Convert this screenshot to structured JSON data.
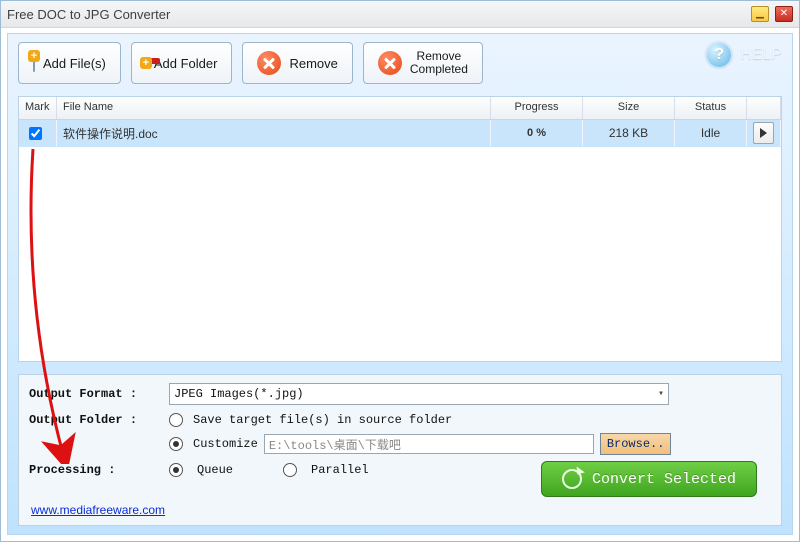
{
  "window": {
    "title": "Free DOC to JPG Converter"
  },
  "toolbar": {
    "add_files": "Add File(s)",
    "add_folder": "Add Folder",
    "remove": "Remove",
    "remove_completed_l1": "Remove",
    "remove_completed_l2": "Completed",
    "help": "HELP"
  },
  "columns": {
    "mark": "Mark",
    "file": "File Name",
    "progress": "Progress",
    "size": "Size",
    "status": "Status"
  },
  "rows": [
    {
      "checked": true,
      "file": "软件操作说明.doc",
      "progress": "0 %",
      "size": "218 KB",
      "status": "Idle"
    }
  ],
  "settings": {
    "output_format_label": "Output Format :",
    "output_format_value": "JPEG Images(*.jpg)",
    "output_folder_label": "Output Folder :",
    "save_in_source": "Save target file(s) in source folder",
    "customize": "Customize",
    "customize_path": "E:\\tools\\桌面\\下载吧",
    "browse": "Browse..",
    "processing_label": "Processing :",
    "queue": "Queue",
    "parallel": "Parallel",
    "convert": "Convert Selected"
  },
  "footer_link": "www.mediafreeware.com"
}
